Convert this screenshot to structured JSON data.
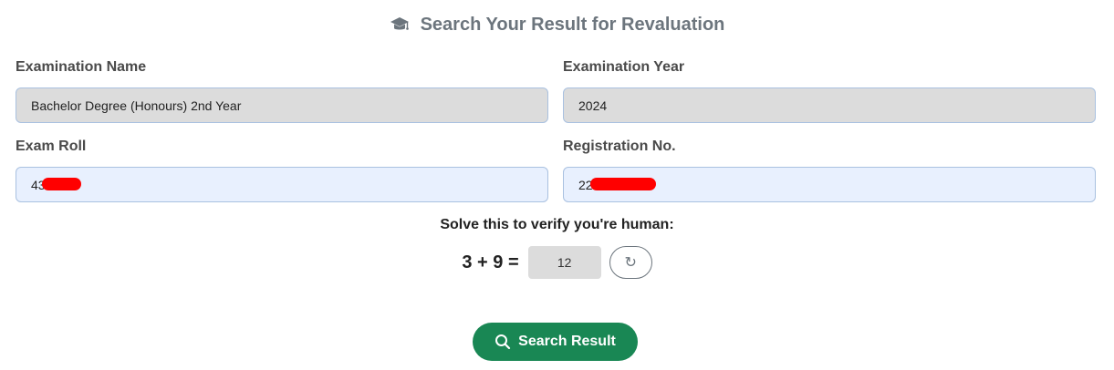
{
  "header": {
    "icon": "graduation-cap-icon",
    "title": "Search Your Result for Revaluation"
  },
  "form": {
    "exam_name": {
      "label": "Examination Name",
      "value": "Bachelor Degree (Honours) 2nd Year"
    },
    "exam_year": {
      "label": "Examination Year",
      "value": "2024"
    },
    "exam_roll": {
      "label": "Exam Roll",
      "value": "43"
    },
    "registration_no": {
      "label": "Registration No.",
      "value": "22"
    }
  },
  "captcha": {
    "prompt": "Solve this to verify you're human:",
    "question": "3 + 9 =",
    "answer": "12",
    "refresh_icon": "refresh-icon",
    "refresh_glyph": "↻"
  },
  "search": {
    "label": "Search Result",
    "icon": "search-icon"
  },
  "colors": {
    "primary_button": "#198754",
    "readonly_field": "#dcdcdc",
    "editable_field": "#e8f0fe",
    "field_border": "#a9c1e0",
    "title_gray": "#6c757d",
    "redaction": "#ff0000"
  }
}
